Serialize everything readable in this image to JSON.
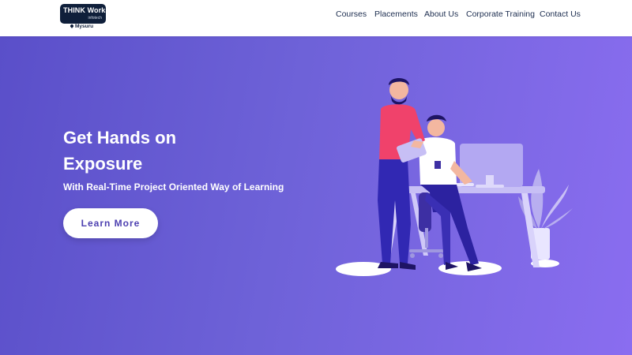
{
  "header": {
    "logo": {
      "main": "THINK Works",
      "sub": "infotech",
      "location": "Mysuru"
    },
    "nav": [
      {
        "label": "Courses"
      },
      {
        "label": "Placements"
      },
      {
        "label": "About Us"
      },
      {
        "label": "Corporate Training"
      },
      {
        "label": "Contact Us"
      }
    ]
  },
  "hero": {
    "title_line1": "Get Hands on",
    "title_line2": "Exposure",
    "subtitle": "With Real-Time Project Oriented Way of Learning",
    "cta_label": "Learn More",
    "colors": {
      "gradient_start": "#5a4fc9",
      "gradient_end": "#8a6df0",
      "accent": "#f0426b"
    }
  }
}
